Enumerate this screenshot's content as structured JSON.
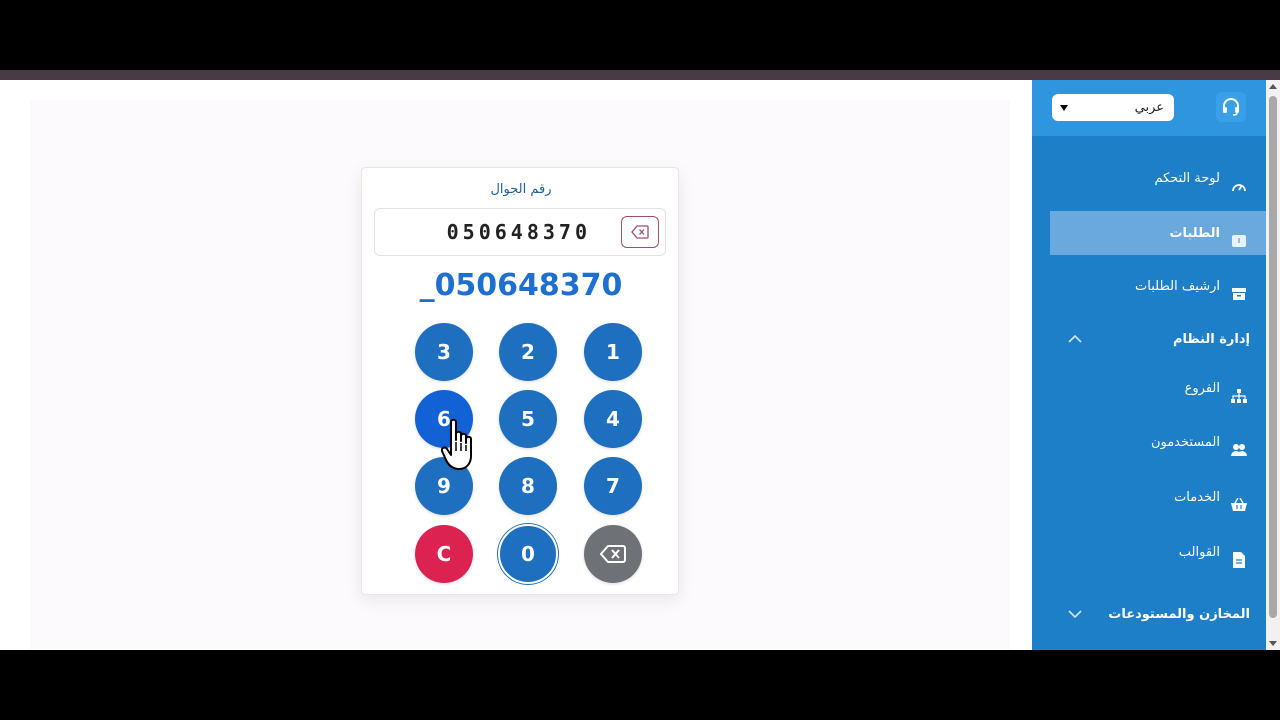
{
  "sidebar": {
    "language": "عربي",
    "items": [
      {
        "label": "لوحة التحكم"
      },
      {
        "label": "الطلبات"
      },
      {
        "label": "ارشيف الطلبات"
      }
    ],
    "system_section": "إدارة النظام",
    "system_items": [
      {
        "label": "الفروع"
      },
      {
        "label": "المستخدمون"
      },
      {
        "label": "الخدمات"
      },
      {
        "label": "القوالب"
      }
    ],
    "warehouse_section": "المخازن والمستودعات"
  },
  "keypad": {
    "label": "رقم الجوال",
    "field_value": "050648370",
    "display_value": "_050648370",
    "keys": {
      "k1": "1",
      "k2": "2",
      "k3": "3",
      "k4": "4",
      "k5": "5",
      "k6": "6",
      "k7": "7",
      "k8": "8",
      "k9": "9",
      "k0": "0",
      "clear": "C"
    }
  },
  "colors": {
    "sidebar": "#1e7fc9",
    "key": "#1f6fc0",
    "clear_key": "#dc2250",
    "back_key": "#6e7276"
  }
}
